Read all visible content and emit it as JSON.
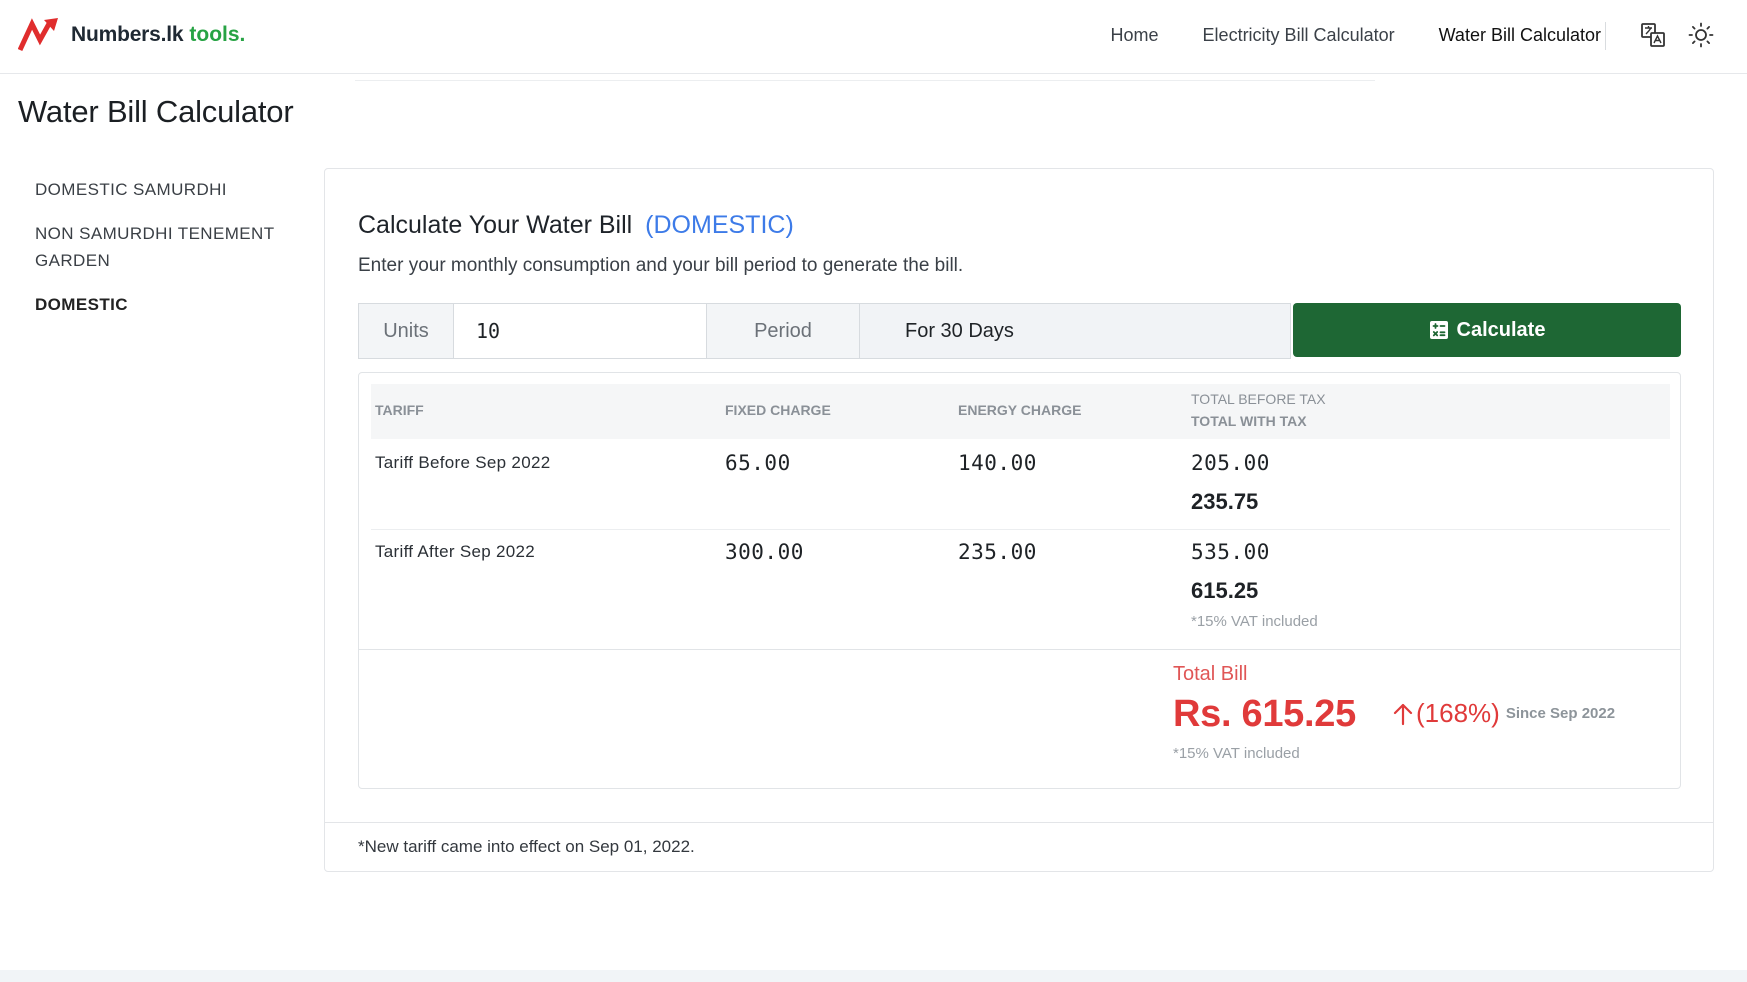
{
  "brand": {
    "name": "Numbers.lk",
    "tools": "tools.",
    "tools_color": "#27a344",
    "logo_color": "#e02d2d"
  },
  "nav": {
    "links": [
      {
        "label": "Home"
      },
      {
        "label": "Electricity Bill Calculator"
      },
      {
        "label": "Water Bill Calculator",
        "active": true
      }
    ],
    "icons": [
      "translate-icon",
      "theme-sun-icon"
    ]
  },
  "page": {
    "title": "Water Bill Calculator"
  },
  "sidebar": {
    "items": [
      {
        "label": "DOMESTIC SAMURDHI"
      },
      {
        "label": "NON SAMURDHI TENEMENT GARDEN"
      },
      {
        "label": "DOMESTIC",
        "active": true
      }
    ]
  },
  "calculator": {
    "title": "Calculate Your Water Bill",
    "category": "(DOMESTIC)",
    "subtitle": "Enter your monthly consumption and your bill period to generate the bill.",
    "units_label": "Units",
    "units_value": "10",
    "period_label": "Period",
    "period_value": "For 30 Days",
    "button_label": "Calculate",
    "button_color": "#1e6734",
    "accent_color": "#3d7be8"
  },
  "table": {
    "headers": {
      "tariff": "TARIFF",
      "fixed": "FIXED CHARGE",
      "energy": "ENERGY CHARGE",
      "before_tax": "TOTAL BEFORE TAX",
      "with_tax": "TOTAL WITH TAX"
    },
    "rows": [
      {
        "tariff": "Tariff Before Sep 2022",
        "fixed": "65.00",
        "energy": "140.00",
        "before_tax": "205.00",
        "with_tax": "235.75",
        "note": ""
      },
      {
        "tariff": "Tariff After Sep 2022",
        "fixed": "300.00",
        "energy": "235.00",
        "before_tax": "535.00",
        "with_tax": "615.25",
        "note": "*15% VAT included"
      }
    ]
  },
  "total": {
    "label": "Total Bill",
    "value": "Rs. 615.25",
    "vat_note": "*15% VAT included",
    "change": "(168%)",
    "since": "Since Sep 2022",
    "color": "#e03a3a"
  },
  "footer_note": "*New tariff came into effect on Sep 01, 2022."
}
